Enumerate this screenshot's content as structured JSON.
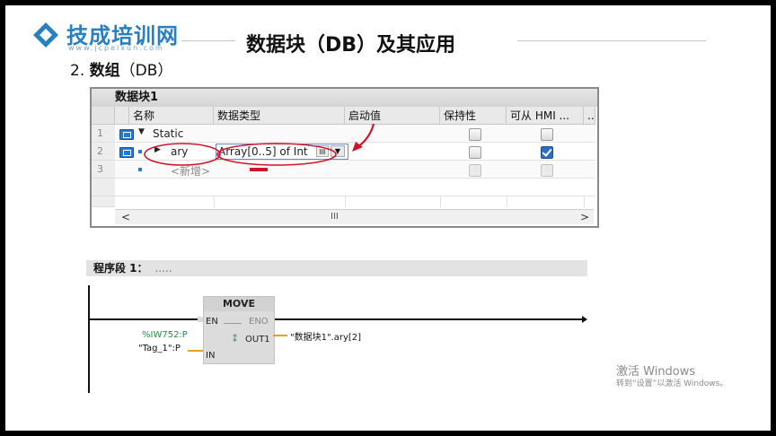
{
  "header": {
    "logo_text": "技成培训网",
    "logo_url": "www.jcpeixun.com",
    "title": "数据块（DB）及其应用",
    "subtitle_prefix": "2.",
    "subtitle_bold": "数组",
    "subtitle_suffix": "（DB）"
  },
  "db_editor": {
    "title": "数据块1",
    "columns": [
      "名称",
      "数据类型",
      "启动值",
      "保持性",
      "可从 HMI ...",
      ".."
    ],
    "rows": [
      {
        "num": "1",
        "name": "Static",
        "type": "",
        "start": "",
        "retain": false,
        "hmi": false
      },
      {
        "num": "2",
        "name": "ary",
        "type": "Array[0..5] of Int",
        "start": "",
        "retain": false,
        "hmi": true
      },
      {
        "num": "3",
        "name": "<新增>",
        "type": "",
        "start": "",
        "retain": false,
        "hmi": false
      }
    ],
    "scroll_left": "<",
    "scroll_right": ">",
    "scroll_thumb": "III"
  },
  "program": {
    "network_label": "程序段 1：",
    "network_comment": ".....",
    "block_title": "MOVE",
    "en": "EN",
    "eno": "ENO",
    "in": "IN",
    "out1": "OUT1",
    "out1_marker": "⁑",
    "in_operand_line1": "%IW752:P",
    "in_operand_line2": "\"Tag_1\":P",
    "out_operand": "\"数据块1\".ary[2]"
  },
  "watermark": {
    "line1": "激活 Windows",
    "line2": "转到“设置”以激活 Windows。"
  },
  "colors": {
    "logo_blue": "#2a7fc1",
    "annotation_red": "#d0152b",
    "operand_green": "#2a8a4a",
    "wire_orange": "#e2a21a",
    "hmi_check_blue": "#2e6fc4"
  }
}
